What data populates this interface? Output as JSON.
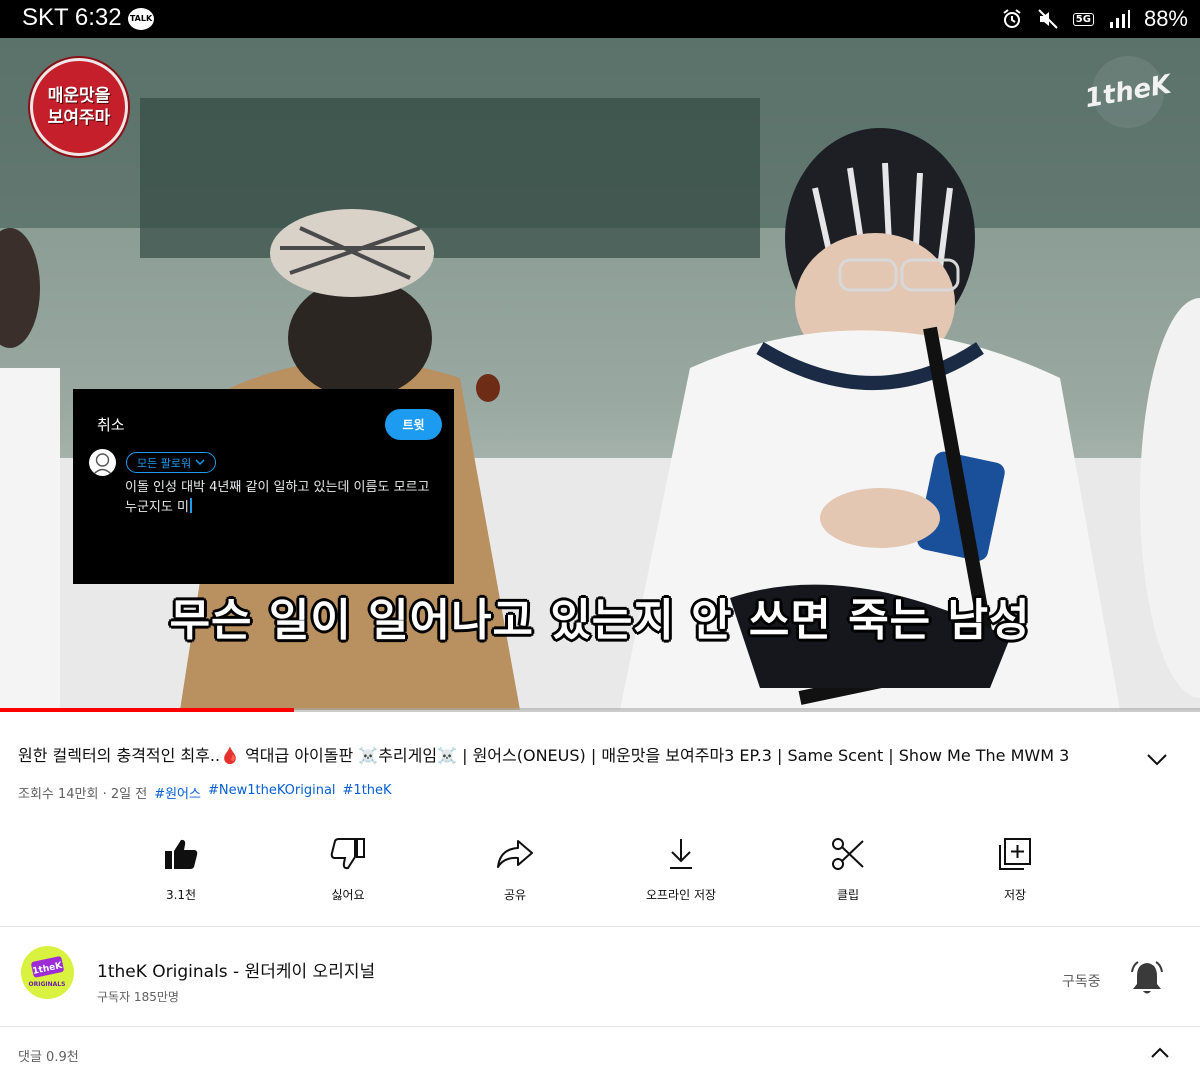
{
  "status_bar": {
    "carrier": "SKT 6:32",
    "talk_badge": "TALK",
    "network": "5G",
    "battery": "88%",
    "icons": [
      "alarm-icon",
      "mute-icon",
      "signal-icon"
    ]
  },
  "video": {
    "show_logo_lines": [
      "매운맛을",
      "보여주마"
    ],
    "brand_mark": "1theK",
    "caption": "무슨 일이 일어나고 있는지 안 쓰면 죽는 남성",
    "progress": 0.245,
    "tweet_overlay": {
      "cancel": "취소",
      "tweet_button": "트윗",
      "audience": "모든 팔로워",
      "text": "이돌 인성 대박 4년째 같이 일하고 있는데 이름도 모르고 누군지도 미"
    }
  },
  "video_info": {
    "title": "원한 컬렉터의 충격적인 최후..🩸 역대급 아이돌판 ☠️추리게임☠️ | 원어스(ONEUS) | 매운맛을 보여주마3 EP.3 | Same Scent | Show Me The MWM 3",
    "views_time": "조회수 14만회 · 2일 전",
    "hashtags": [
      "#원어스",
      "#New1theKOriginal",
      "#1theK"
    ]
  },
  "actions": [
    {
      "label": "3.1천",
      "icon": "thumbs-up-icon"
    },
    {
      "label": "싫어요",
      "icon": "thumbs-down-icon"
    },
    {
      "label": "공유",
      "icon": "share-icon"
    },
    {
      "label": "오프라인 저장",
      "icon": "download-icon"
    },
    {
      "label": "클립",
      "icon": "scissors-icon"
    },
    {
      "label": "저장",
      "icon": "add-to-playlist-icon"
    }
  ],
  "channel": {
    "avatar_text": "1theK",
    "avatar_sub": "ORIGINALS",
    "name": "1theK Originals - 원더케이 오리지널",
    "subscribers": "구독자 185만명",
    "subscribed_label": "구독중"
  },
  "comments": {
    "label": "댓글 0.9천"
  },
  "colors": {
    "accent_red": "#ff0000",
    "link_blue": "#065fd4",
    "twitter_blue": "#1d9bf0"
  }
}
